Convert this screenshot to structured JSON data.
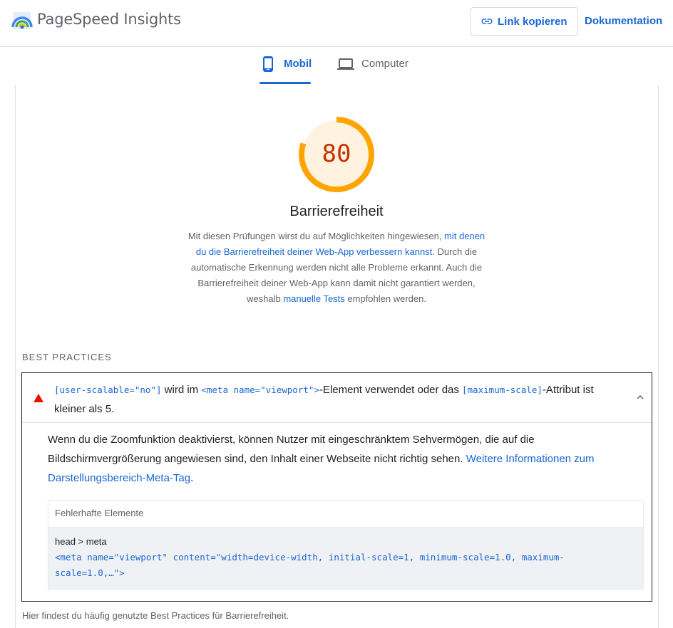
{
  "header": {
    "app_title": "PageSpeed Insights",
    "copy_link_label": "Link kopieren",
    "docs_label": "Dokumentation"
  },
  "tabs": [
    {
      "label": "Mobil",
      "selected": true
    },
    {
      "label": "Computer",
      "selected": false
    }
  ],
  "category": {
    "score": "80",
    "score_fraction": 0.8,
    "score_color": "#ffa400",
    "title": "Barrierefreiheit",
    "desc_1": "Mit diesen Prüfungen wirst du auf Möglichkeiten hingewiesen, ",
    "desc_link_1": "mit denen du die Barrierefreiheit deiner Web-App verbessern kannst",
    "desc_2": ". Durch die automatische Erkennung werden nicht alle Probleme erkannt. Auch die Barrierefreiheit deiner Web-App kann damit nicht garantiert werden, weshalb ",
    "desc_link_2": "manuelle Tests",
    "desc_3": " empfohlen werden."
  },
  "group": {
    "title": "BEST PRACTICES",
    "description": "Hier findest du häufig genutzte Best Practices für Barrierefreiheit."
  },
  "audit": {
    "title_code_1": "[user-scalable=\"no\"]",
    "title_text_1": " wird im ",
    "title_code_2": "<meta name=\"viewport\">",
    "title_text_2": "-Element verwendet oder das ",
    "title_code_3": "[maximum-scale]",
    "title_text_3": "-Attribut ist kleiner als 5.",
    "description": "Wenn du die Zoomfunktion deaktivierst, können Nutzer mit eingeschränktem Sehvermögen, die auf die Bildschirmvergrößerung angewiesen sind, den Inhalt einer Webseite nicht richtig sehen. ",
    "learn_more": "Weitere Informationen zum Darstellungsbereich-Meta-Tag",
    "desc_end": ".",
    "table_header": "Fehlerhafte Elemente",
    "node_label": "head > meta",
    "node_snippet": "<meta name=\"viewport\" content=\"width=device-width, initial-scale=1, minimum-scale=1.0, maximum-scale=1.0,…\">"
  }
}
